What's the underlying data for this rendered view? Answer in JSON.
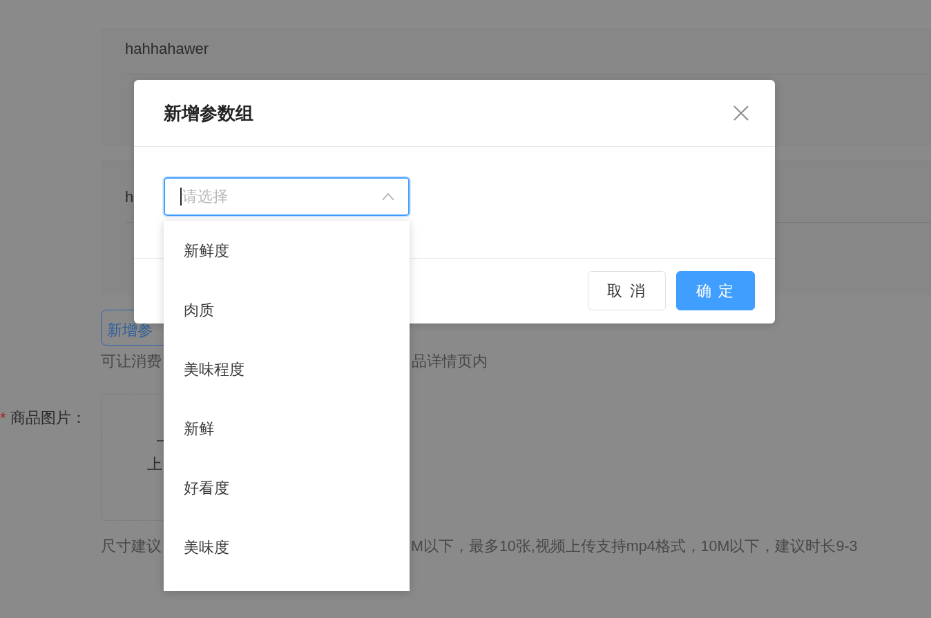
{
  "background": {
    "param_cards": [
      {
        "name": "hahhahawer"
      },
      {
        "name": "h"
      }
    ],
    "add_button": "新增参",
    "hint": [
      "可让消费",
      "品详情页内"
    ],
    "image_field": {
      "required_mark": "*",
      "label": "商品图片：",
      "upload_text": "上"
    },
    "size_hint": [
      "尺寸建议",
      "M以下，最多10张,视频上传支持mp4格式，10M以下，建议时长9-3"
    ]
  },
  "dialog": {
    "title": "新增参数组",
    "select": {
      "placeholder": "请选择",
      "expanded": true,
      "options": [
        {
          "label": "新鲜度",
          "selected": false
        },
        {
          "label": "肉质",
          "selected": false
        },
        {
          "label": "美味程度",
          "selected": false
        },
        {
          "label": "新鲜",
          "selected": false
        },
        {
          "label": "好看度",
          "selected": false
        },
        {
          "label": "美味度",
          "selected": false
        }
      ]
    },
    "buttons": [
      {
        "label": "取 消",
        "kind": "default"
      },
      {
        "label": "确 定",
        "kind": "primary"
      }
    ]
  }
}
